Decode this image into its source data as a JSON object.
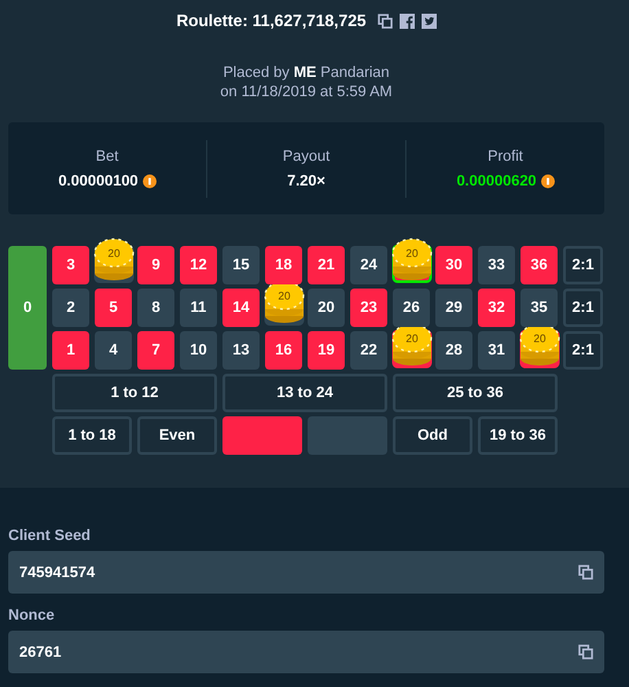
{
  "header": {
    "title": "Roulette: 11,627,718,725",
    "placed_by": "Placed by **ME** Pandarian",
    "date": "on 11/18/2019 at 5:59 AM"
  },
  "stats": [
    {
      "label": "Bet",
      "value": "0.00000100",
      "kind": "plain",
      "coin": true
    },
    {
      "label": "Payout",
      "value": "7.20×",
      "kind": "plain",
      "coin": false
    },
    {
      "label": "Profit",
      "value": "0.00000620",
      "kind": "profit",
      "coin": true
    }
  ],
  "board": {
    "zero": {
      "label": "0",
      "color": "#419e3f"
    },
    "rows": [
      [
        {
          "label": "3",
          "color": "#fe2247",
          "winning": false
        },
        {
          "chip": "20",
          "color": "#2f4553",
          "winning": false
        },
        {
          "label": "9",
          "color": "#fe2247",
          "winning": false
        },
        {
          "label": "12",
          "color": "#fe2247",
          "winning": false
        },
        {
          "label": "15",
          "color": "#2f4553",
          "winning": false
        },
        {
          "label": "18",
          "color": "#fe2247",
          "winning": false
        },
        {
          "label": "21",
          "color": "#fe2247",
          "winning": false
        },
        {
          "label": "24",
          "color": "#2f4553",
          "winning": false
        },
        {
          "chip": "20",
          "color": "#fe2247",
          "winning": true
        },
        {
          "label": "30",
          "color": "#fe2247",
          "winning": false
        },
        {
          "label": "33",
          "color": "#2f4553",
          "winning": false
        },
        {
          "label": "36",
          "color": "#fe2247",
          "winning": false
        }
      ],
      [
        {
          "label": "2",
          "color": "#2f4553",
          "winning": false
        },
        {
          "label": "5",
          "color": "#fe2247",
          "winning": false
        },
        {
          "label": "8",
          "color": "#2f4553",
          "winning": false
        },
        {
          "label": "11",
          "color": "#2f4553",
          "winning": false
        },
        {
          "label": "14",
          "color": "#fe2247",
          "winning": false
        },
        {
          "chip": "20",
          "color": "#2f4553",
          "winning": false
        },
        {
          "label": "20",
          "color": "#2f4553",
          "winning": false
        },
        {
          "label": "23",
          "color": "#fe2247",
          "winning": false
        },
        {
          "label": "26",
          "color": "#2f4553",
          "winning": false
        },
        {
          "label": "29",
          "color": "#2f4553",
          "winning": false
        },
        {
          "label": "32",
          "color": "#fe2247",
          "winning": false
        },
        {
          "label": "35",
          "color": "#2f4553",
          "winning": false
        }
      ],
      [
        {
          "label": "1",
          "color": "#fe2247",
          "winning": false
        },
        {
          "label": "4",
          "color": "#2f4553",
          "winning": false
        },
        {
          "label": "7",
          "color": "#fe2247",
          "winning": false
        },
        {
          "label": "10",
          "color": "#2f4553",
          "winning": false
        },
        {
          "label": "13",
          "color": "#2f4553",
          "winning": false
        },
        {
          "label": "16",
          "color": "#fe2247",
          "winning": false
        },
        {
          "label": "19",
          "color": "#fe2247",
          "winning": false
        },
        {
          "label": "22",
          "color": "#2f4553",
          "winning": false
        },
        {
          "chip": "20",
          "color": "#fe2247",
          "winning": false
        },
        {
          "label": "28",
          "color": "#2f4553",
          "winning": false
        },
        {
          "label": "31",
          "color": "#2f4553",
          "winning": false
        },
        {
          "chip": "20",
          "color": "#fe2247",
          "winning": false
        }
      ]
    ],
    "column_bets": [
      "2:1",
      "2:1",
      "2:1"
    ],
    "dozens": [
      "1 to 12",
      "13 to 24",
      "25 to 36"
    ],
    "outside": [
      {
        "kind": "text",
        "label": "1 to 18"
      },
      {
        "kind": "text",
        "label": "Even"
      },
      {
        "kind": "swatch",
        "color": "#fe2247"
      },
      {
        "kind": "swatch",
        "color": "#2f4553"
      },
      {
        "kind": "text",
        "label": "Odd"
      },
      {
        "kind": "text",
        "label": "19 to 36"
      }
    ]
  },
  "fields": [
    {
      "label": "Client Seed",
      "value": "745941574"
    },
    {
      "label": "Nonce",
      "value": "26761"
    }
  ]
}
